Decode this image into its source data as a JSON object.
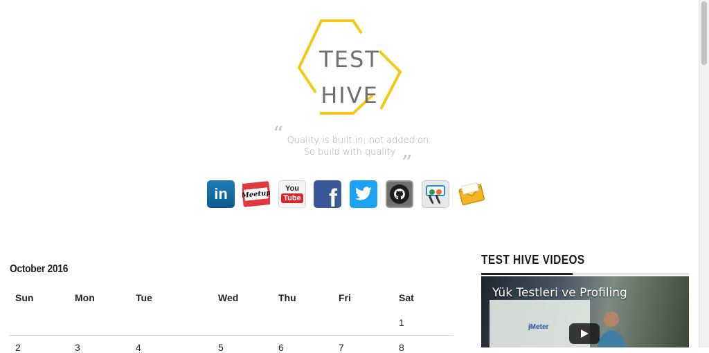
{
  "logo": {
    "line1": "TEST",
    "line2": "HIVE",
    "accent_color": "#f5c915"
  },
  "quote": {
    "line1": "Quality is built in, not added on.",
    "line2": "So build with quality"
  },
  "social": [
    {
      "name": "linkedin-icon",
      "glyph": "in"
    },
    {
      "name": "meetup-icon",
      "glyph": "Meetup"
    },
    {
      "name": "youtube-icon",
      "glyph": "You",
      "glyph2": "Tube"
    },
    {
      "name": "facebook-icon",
      "glyph": "f"
    },
    {
      "name": "twitter-icon",
      "glyph": ""
    },
    {
      "name": "github-icon",
      "glyph": ""
    },
    {
      "name": "slideshare-icon",
      "glyph": ""
    },
    {
      "name": "email-icon",
      "glyph": ""
    }
  ],
  "calendar": {
    "title": "October 2016",
    "days": [
      "Sun",
      "Mon",
      "Tue",
      "Wed",
      "Thu",
      "Fri",
      "Sat"
    ],
    "row1": [
      "",
      "",
      "",
      "",
      "",
      "",
      "1"
    ],
    "row2": [
      "2",
      "3",
      "4",
      "5",
      "6",
      "7",
      "8"
    ]
  },
  "videos_widget": {
    "title": "TEST HIVE VIDEOS",
    "video_title": "Yük Testleri ve Profiling",
    "slide_label": "jMeter"
  }
}
